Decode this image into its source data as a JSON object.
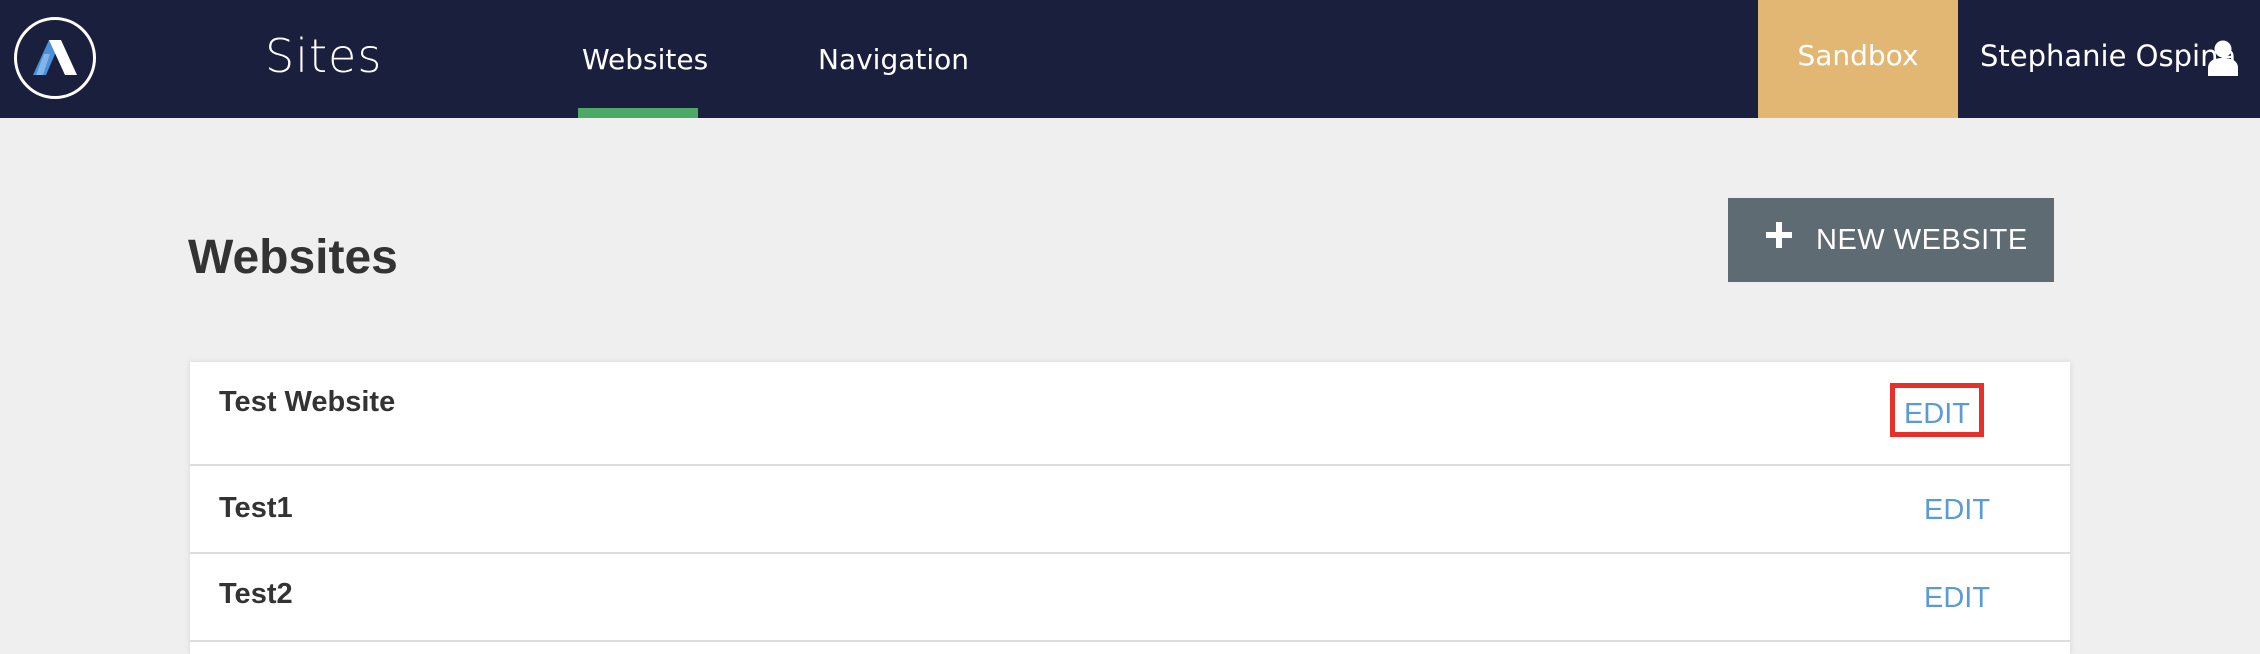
{
  "header": {
    "logo_icon": "app-logo-icon",
    "app_title": "Sites",
    "tabs": [
      {
        "label": "Websites",
        "active": true
      },
      {
        "label": "Navigation",
        "active": false
      }
    ],
    "environment_label": "Sandbox",
    "user_name": "Stephanie Ospina",
    "user_icon": "user-icon",
    "colors": {
      "background": "#1b1f3e",
      "active_tab_underline": "#4caa66",
      "sandbox": "#e2b774"
    }
  },
  "main": {
    "page_title": "Websites",
    "new_button": {
      "icon": "plus-icon",
      "label": "NEW WEBSITE",
      "color": "#5f6b73"
    },
    "websites": [
      {
        "name": "Test Website",
        "action_label": "EDIT"
      },
      {
        "name": "Test1",
        "action_label": "EDIT"
      },
      {
        "name": "Test2",
        "action_label": "EDIT"
      }
    ],
    "colors": {
      "background": "#efefef",
      "link": "#5b9bd5",
      "highlight_box": "#e8302b"
    }
  }
}
